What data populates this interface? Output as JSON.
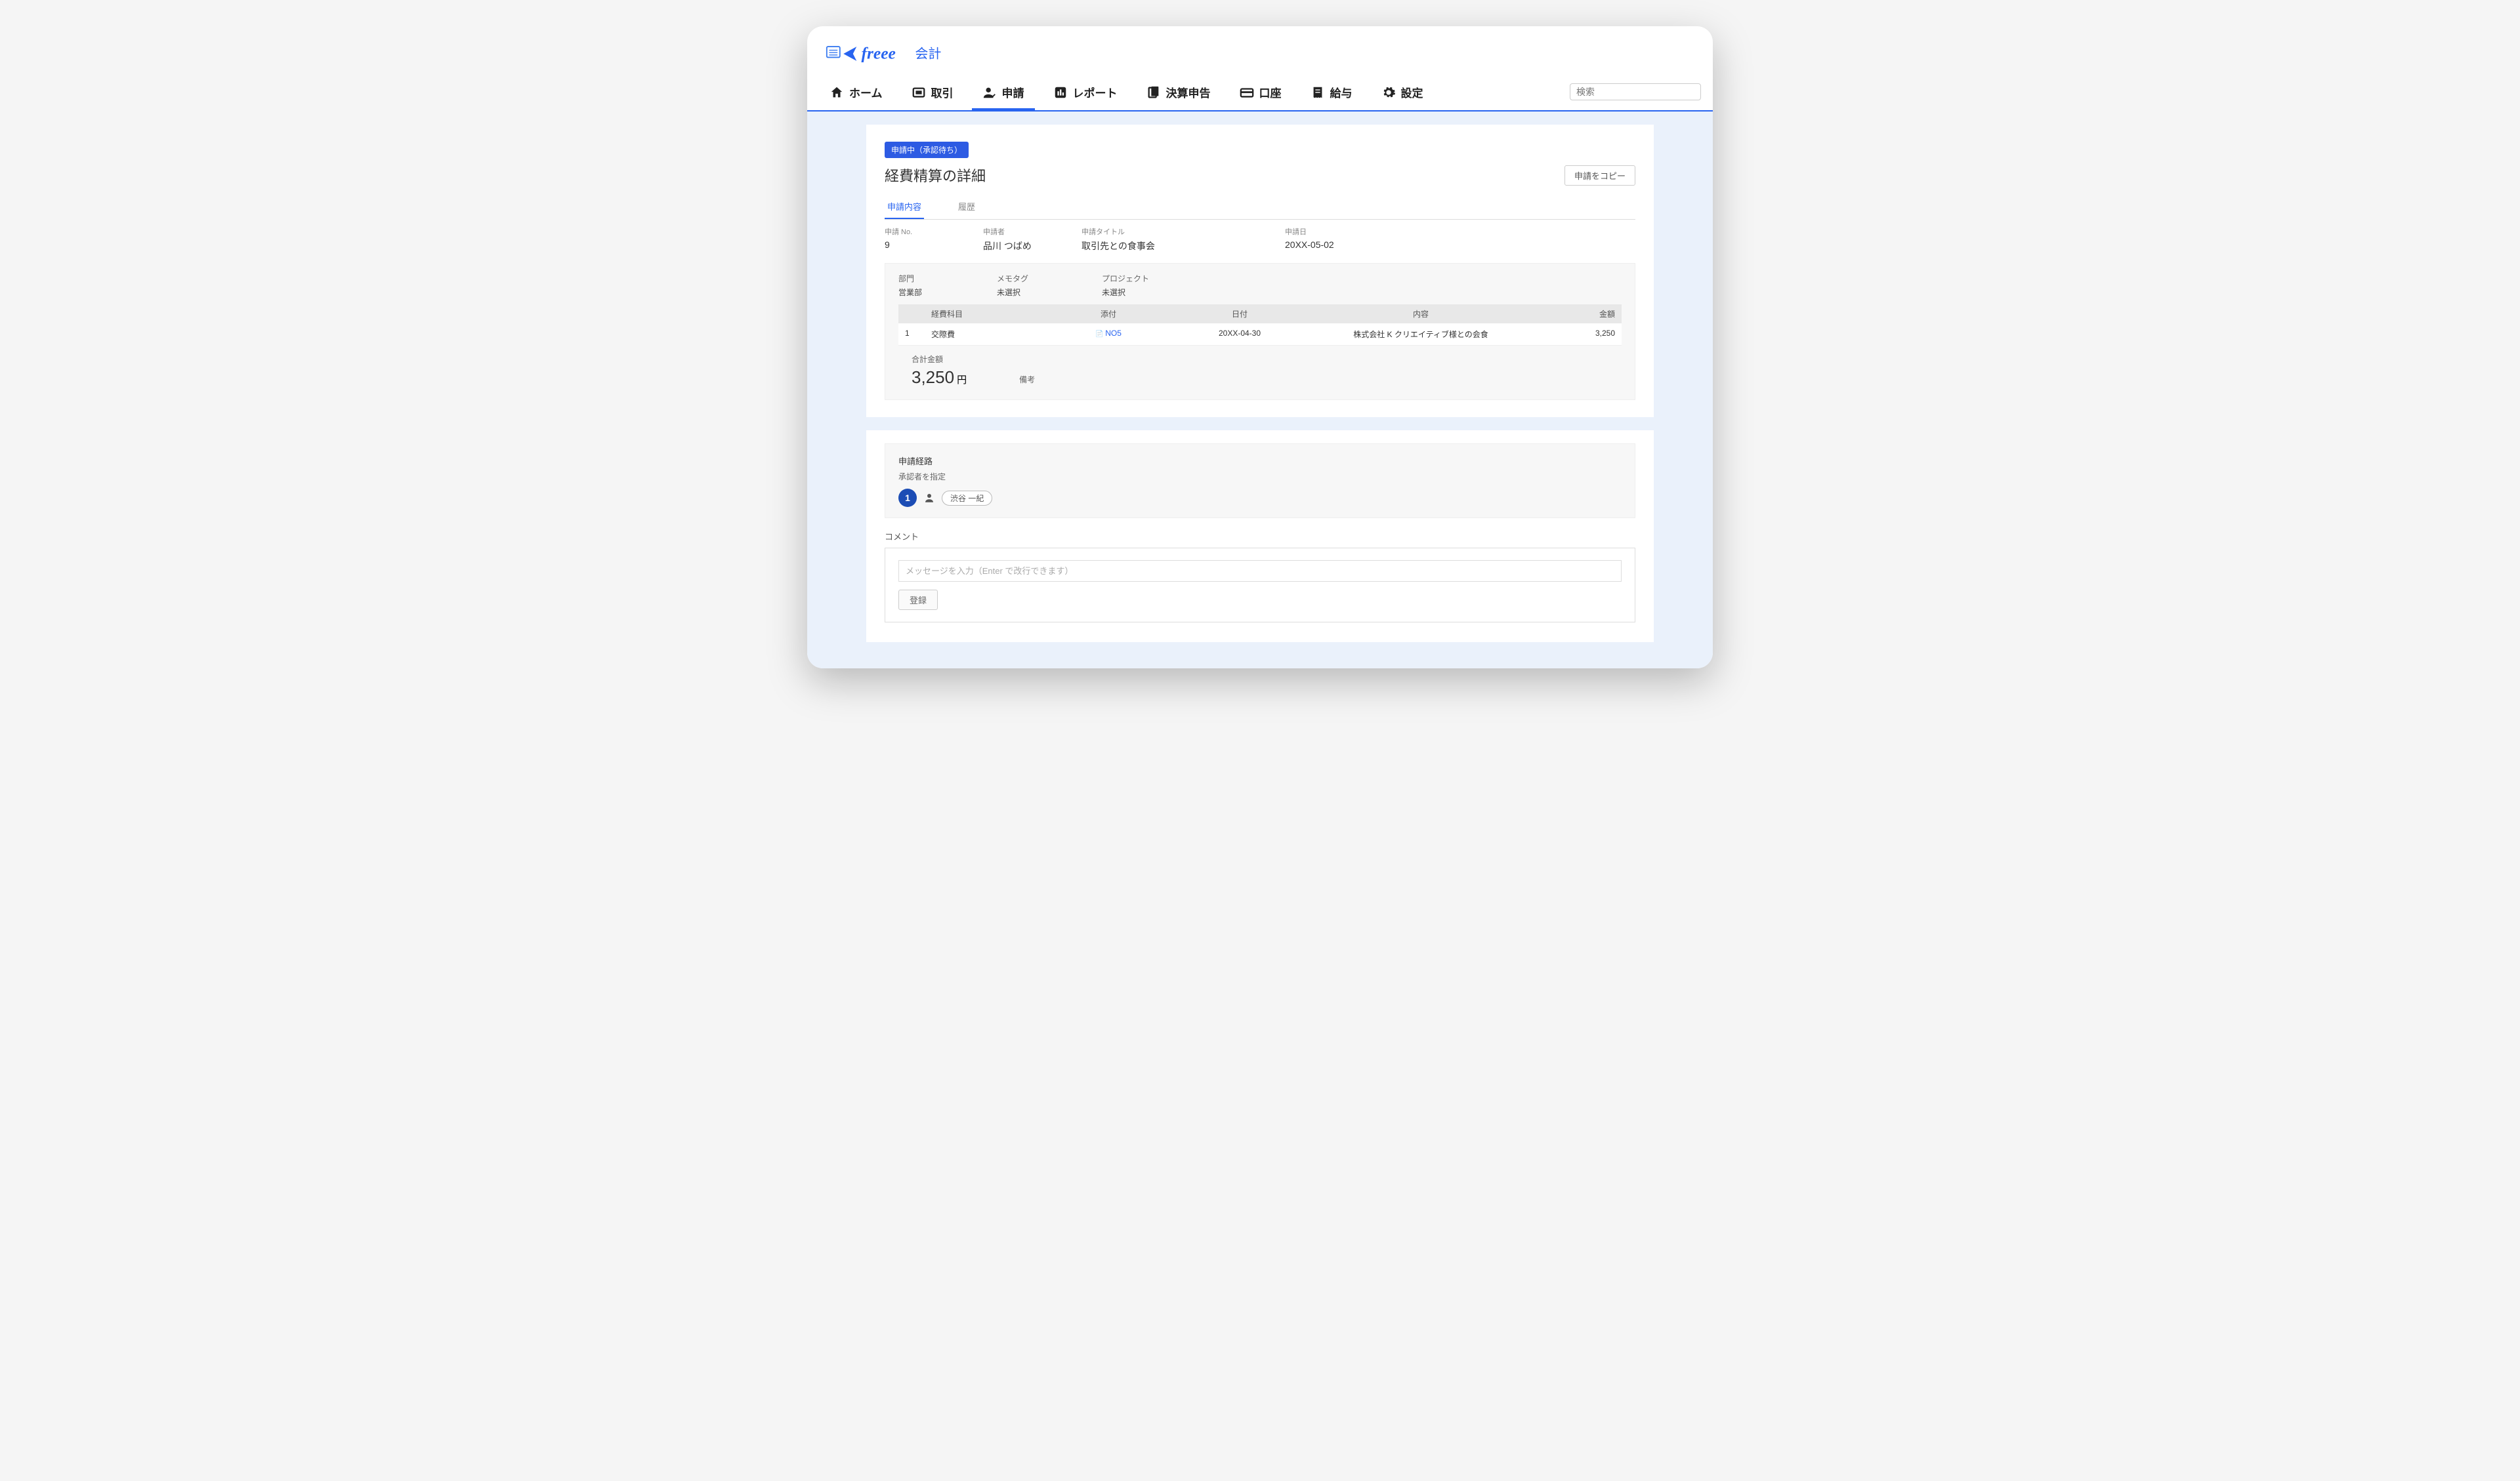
{
  "brand": {
    "name": "freee",
    "product": "会計"
  },
  "nav": {
    "items": [
      {
        "label": "ホーム"
      },
      {
        "label": "取引"
      },
      {
        "label": "申請"
      },
      {
        "label": "レポート"
      },
      {
        "label": "決算申告"
      },
      {
        "label": "口座"
      },
      {
        "label": "給与"
      },
      {
        "label": "設定"
      }
    ],
    "search_placeholder": "検索"
  },
  "status": {
    "label": "申請中（承認待ち）"
  },
  "page": {
    "title": "経費精算の詳細",
    "copy_btn": "申請をコピー"
  },
  "tabs": {
    "content": "申請内容",
    "history": "履歴"
  },
  "meta": {
    "no_label": "申請 No.",
    "no": "9",
    "applicant_label": "申請者",
    "applicant": "品川 つばめ",
    "title_label": "申請タイトル",
    "title": "取引先との食事会",
    "date_label": "申請日",
    "date": "20XX-05-02"
  },
  "detail": {
    "dept_label": "部門",
    "dept": "営業部",
    "memo_label": "メモタグ",
    "memo": "未選択",
    "project_label": "プロジェクト",
    "project": "未選択",
    "cols": {
      "idx": "",
      "account": "経費科目",
      "attach": "添付",
      "date": "日付",
      "desc": "内容",
      "amount": "金額"
    },
    "rows": [
      {
        "idx": "1",
        "account": "交際費",
        "attach": "NO5",
        "date": "20XX-04-30",
        "desc": "株式会社 K クリエイティブ様との会食",
        "amount": "3,250"
      }
    ],
    "total_label": "合計金額",
    "total": "3,250",
    "unit": "円",
    "note_label": "備考"
  },
  "route": {
    "title": "申請経路",
    "sub": "承認者を指定",
    "step": "1",
    "approver": "渋谷 一紀"
  },
  "comment": {
    "label": "コメント",
    "placeholder": "メッセージを入力（Enter で改行できます）",
    "submit": "登録"
  }
}
